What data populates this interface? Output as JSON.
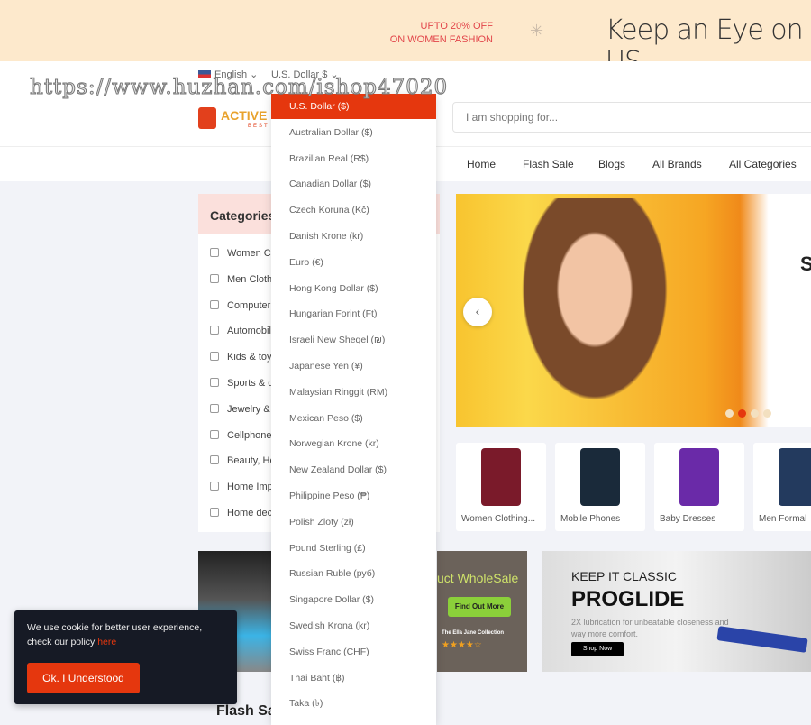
{
  "promo": {
    "line1": "UPTO 20% OFF",
    "line2": "ON WOMEN FASHION",
    "tagline": "Keep an Eye on US"
  },
  "topbar": {
    "language": "English",
    "currency": "U.S. Dollar $"
  },
  "header": {
    "logo": "ACTIVE",
    "logo_sub": "BEST",
    "search_placeholder": "I am shopping for..."
  },
  "nav": [
    "Home",
    "Flash Sale",
    "Blogs",
    "All Brands",
    "All Categories"
  ],
  "categories": {
    "title": "Categories",
    "items": [
      "Women Clothing",
      "Men Clothing",
      "Computer",
      "Automobile",
      "Kids & toys",
      "Sports & outdoor",
      "Jewelry & Watches",
      "Cellphones",
      "Beauty, Health",
      "Home Improvement",
      "Home decoration"
    ]
  },
  "hero": {
    "partial_text": "S"
  },
  "products": [
    "Women Clothing...",
    "Mobile Phones",
    "Baby Dresses",
    "Men Formal"
  ],
  "banners": {
    "wholesale_title": "uct WholeSale",
    "wholesale_button": "Find Out More",
    "wholesale_caption": "The Ella Jane Collection",
    "wholesale_stars": "★★★★☆",
    "classic_kicker": "KEEP IT CLASSIC",
    "classic_title": "PROGLIDE",
    "classic_desc": "2X lubrication for unbeatable closeness and way more comfort.",
    "classic_button": "Shop Now"
  },
  "flash_sale_title": "Flash Sa",
  "currency_dropdown": {
    "selected": 0,
    "options": [
      "U.S. Dollar ($)",
      "Australian Dollar ($)",
      "Brazilian Real (R$)",
      "Canadian Dollar ($)",
      "Czech Koruna (Kč)",
      "Danish Krone (kr)",
      "Euro (€)",
      "Hong Kong Dollar ($)",
      "Hungarian Forint (Ft)",
      "Israeli New Sheqel (₪)",
      "Japanese Yen (¥)",
      "Malaysian Ringgit (RM)",
      "Mexican Peso ($)",
      "Norwegian Krone (kr)",
      "New Zealand Dollar ($)",
      "Philippine Peso (₱)",
      "Polish Zloty (zł)",
      "Pound Sterling (£)",
      "Russian Ruble (руб)",
      "Singapore Dollar ($)",
      "Swedish Krona (kr)",
      "Swiss Franc (CHF)",
      "Thai Baht (฿)",
      "Taka (৳)"
    ]
  },
  "cookie": {
    "text": "We use cookie for better user experience, check our policy ",
    "link": "here",
    "button": "Ok. I Understood"
  },
  "watermark": "https://www.huzhan.com/ishop47020",
  "colors": {
    "accent": "#e5370e",
    "promo_bg": "#fde9cc",
    "category_header": "#fbe0dc"
  }
}
